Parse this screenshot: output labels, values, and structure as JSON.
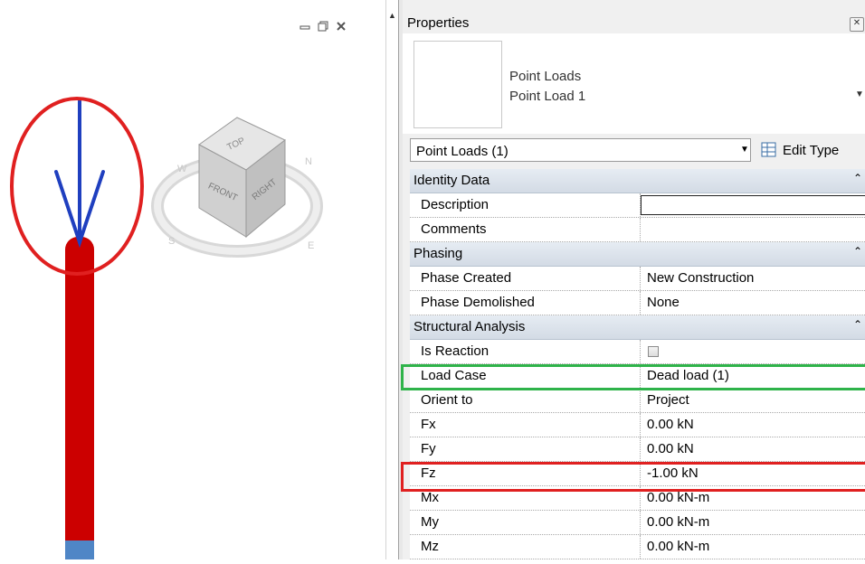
{
  "properties": {
    "title": "Properties",
    "type_selector": {
      "family": "Point Loads",
      "type": "Point Load 1"
    },
    "instance_selector": "Point Loads (1)",
    "edit_type_label": "Edit Type",
    "groups": {
      "identity_data": {
        "label": "Identity Data",
        "rows": {
          "description": {
            "name": "Description",
            "value": ""
          },
          "comments": {
            "name": "Comments",
            "value": ""
          }
        }
      },
      "phasing": {
        "label": "Phasing",
        "rows": {
          "phase_created": {
            "name": "Phase Created",
            "value": "New Construction"
          },
          "phase_demolished": {
            "name": "Phase Demolished",
            "value": "None"
          }
        }
      },
      "structural_analysis": {
        "label": "Structural Analysis",
        "rows": {
          "is_reaction": {
            "name": "Is Reaction",
            "checked": false
          },
          "load_case": {
            "name": "Load Case",
            "value": "Dead load (1)"
          },
          "orient_to": {
            "name": "Orient to",
            "value": "Project"
          },
          "fx": {
            "name": "Fx",
            "value": "0.00 kN"
          },
          "fy": {
            "name": "Fy",
            "value": "0.00 kN"
          },
          "fz": {
            "name": "Fz",
            "value": "-1.00 kN"
          },
          "mx": {
            "name": "Mx",
            "value": "0.00 kN-m"
          },
          "my": {
            "name": "My",
            "value": "0.00 kN-m"
          },
          "mz": {
            "name": "Mz",
            "value": "0.00 kN-m"
          }
        }
      }
    }
  },
  "viewcube": {
    "top": "TOP",
    "front": "FRONT",
    "right": "RIGHT",
    "compass": [
      "N",
      "E",
      "S",
      "W"
    ]
  },
  "colors": {
    "load_arrow": "#1f3fbf",
    "member": "#cc0000",
    "annotation_red": "#e02020",
    "annotation_green": "#2fb34a"
  }
}
